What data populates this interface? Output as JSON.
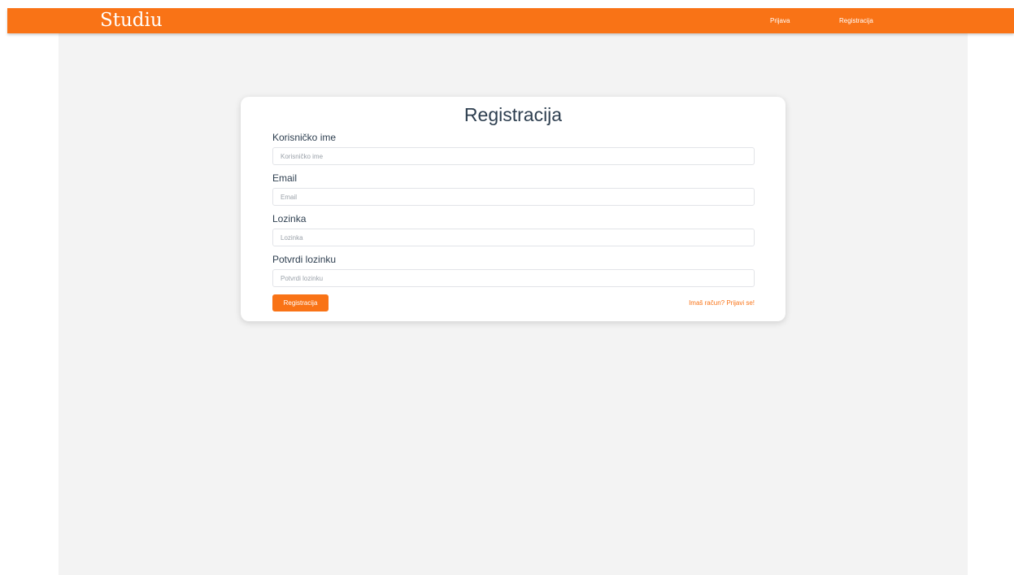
{
  "navbar": {
    "brand": "Studiu",
    "links": [
      "Prijava",
      "Registracija"
    ]
  },
  "form": {
    "title": "Registracija",
    "fields": [
      {
        "label": "Korisničko ime",
        "placeholder": "Korisničko ime",
        "value": ""
      },
      {
        "label": "Email",
        "placeholder": "Email",
        "value": ""
      },
      {
        "label": "Lozinka",
        "placeholder": "Lozinka",
        "value": ""
      },
      {
        "label": "Potvrdi lozinku",
        "placeholder": "Potvrdi lozinku",
        "value": ""
      }
    ],
    "submit_label": "Registracija",
    "login_link": "Imaš račun? Prijavi se!"
  },
  "colors": {
    "accent": "#f97316",
    "text": "#2d3e4f",
    "background": "#f3f3f3"
  }
}
